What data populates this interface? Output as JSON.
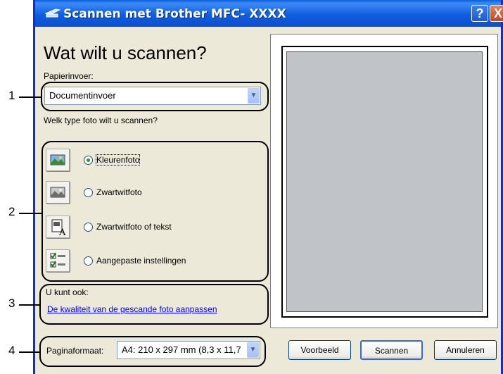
{
  "window": {
    "title": "Scannen met Brother MFC- XXXX",
    "help_label": "?",
    "close_label": "X"
  },
  "main": {
    "heading": "Wat wilt u scannen?",
    "paper_source_label": "Papierinvoer:",
    "paper_source_value": "Documentinvoer",
    "photo_type_question": "Welk type foto wilt u scannen?",
    "options": [
      {
        "label": "Kleurenfoto",
        "selected": true,
        "icon": "color-photo-icon"
      },
      {
        "label": "Zwartwitfoto",
        "selected": false,
        "icon": "grayscale-photo-icon"
      },
      {
        "label": "Zwartwitfoto of tekst",
        "selected": false,
        "icon": "text-document-icon"
      },
      {
        "label": "Aangepaste instellingen",
        "selected": false,
        "icon": "custom-settings-icon"
      }
    ],
    "also_label": "U kunt ook:",
    "quality_link": "De kwaliteit van de gescande foto aanpassen",
    "page_size_label": "Paginaformaat:",
    "page_size_value": "A4: 210 x 297 mm (8,3 x 11,7"
  },
  "buttons": {
    "preview": "Voorbeeld",
    "scan": "Scannen",
    "cancel": "Annuleren"
  },
  "callouts": [
    "1",
    "2",
    "3",
    "4"
  ],
  "colors": {
    "titlebar": "#0a5fd8",
    "dialog_bg": "#ece9d8",
    "link": "#0000ff",
    "preview_area": "#c0c4c8"
  }
}
